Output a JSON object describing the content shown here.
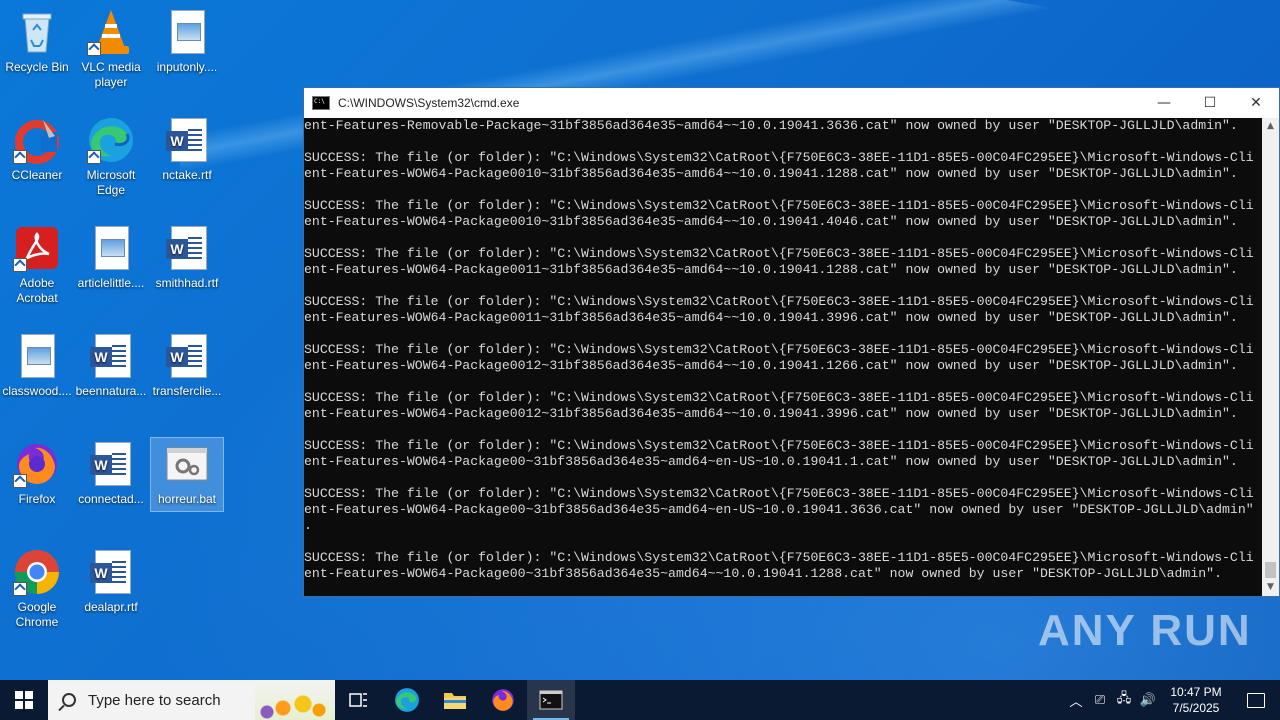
{
  "desktop": {
    "icons": [
      {
        "label": "Recycle Bin"
      },
      {
        "label": "VLC media player"
      },
      {
        "label": "inputonly...."
      },
      {
        "label": "CCleaner"
      },
      {
        "label": "Microsoft Edge"
      },
      {
        "label": "nctake.rtf"
      },
      {
        "label": "Adobe Acrobat"
      },
      {
        "label": "articlelittle...."
      },
      {
        "label": "smithhad.rtf"
      },
      {
        "label": "classwood...."
      },
      {
        "label": "beennatura..."
      },
      {
        "label": "transferclie..."
      },
      {
        "label": "Firefox"
      },
      {
        "label": "connectad..."
      },
      {
        "label": "horreur.bat"
      },
      {
        "label": "Google Chrome"
      },
      {
        "label": "dealapr.rtf"
      }
    ]
  },
  "cmd": {
    "title": "C:\\WINDOWS\\System32\\cmd.exe",
    "controls": {
      "minimize": "—",
      "maximize": "☐",
      "close": "✕"
    },
    "lines": [
      "ent-Features-Removable-Package~31bf3856ad364e35~amd64~~10.0.19041.3636.cat\" now owned by user \"DESKTOP-JGLLJLD\\admin\".",
      "",
      "SUCCESS: The file (or folder): \"C:\\Windows\\System32\\CatRoot\\{F750E6C3-38EE-11D1-85E5-00C04FC295EE}\\Microsoft-Windows-Cli",
      "ent-Features-WOW64-Package0010~31bf3856ad364e35~amd64~~10.0.19041.1288.cat\" now owned by user \"DESKTOP-JGLLJLD\\admin\".",
      "",
      "SUCCESS: The file (or folder): \"C:\\Windows\\System32\\CatRoot\\{F750E6C3-38EE-11D1-85E5-00C04FC295EE}\\Microsoft-Windows-Cli",
      "ent-Features-WOW64-Package0010~31bf3856ad364e35~amd64~~10.0.19041.4046.cat\" now owned by user \"DESKTOP-JGLLJLD\\admin\".",
      "",
      "SUCCESS: The file (or folder): \"C:\\Windows\\System32\\CatRoot\\{F750E6C3-38EE-11D1-85E5-00C04FC295EE}\\Microsoft-Windows-Cli",
      "ent-Features-WOW64-Package0011~31bf3856ad364e35~amd64~~10.0.19041.1288.cat\" now owned by user \"DESKTOP-JGLLJLD\\admin\".",
      "",
      "SUCCESS: The file (or folder): \"C:\\Windows\\System32\\CatRoot\\{F750E6C3-38EE-11D1-85E5-00C04FC295EE}\\Microsoft-Windows-Cli",
      "ent-Features-WOW64-Package0011~31bf3856ad364e35~amd64~~10.0.19041.3996.cat\" now owned by user \"DESKTOP-JGLLJLD\\admin\".",
      "",
      "SUCCESS: The file (or folder): \"C:\\Windows\\System32\\CatRoot\\{F750E6C3-38EE-11D1-85E5-00C04FC295EE}\\Microsoft-Windows-Cli",
      "ent-Features-WOW64-Package0012~31bf3856ad364e35~amd64~~10.0.19041.1266.cat\" now owned by user \"DESKTOP-JGLLJLD\\admin\".",
      "",
      "SUCCESS: The file (or folder): \"C:\\Windows\\System32\\CatRoot\\{F750E6C3-38EE-11D1-85E5-00C04FC295EE}\\Microsoft-Windows-Cli",
      "ent-Features-WOW64-Package0012~31bf3856ad364e35~amd64~~10.0.19041.3996.cat\" now owned by user \"DESKTOP-JGLLJLD\\admin\".",
      "",
      "SUCCESS: The file (or folder): \"C:\\Windows\\System32\\CatRoot\\{F750E6C3-38EE-11D1-85E5-00C04FC295EE}\\Microsoft-Windows-Cli",
      "ent-Features-WOW64-Package00~31bf3856ad364e35~amd64~en-US~10.0.19041.1.cat\" now owned by user \"DESKTOP-JGLLJLD\\admin\".",
      "",
      "SUCCESS: The file (or folder): \"C:\\Windows\\System32\\CatRoot\\{F750E6C3-38EE-11D1-85E5-00C04FC295EE}\\Microsoft-Windows-Cli",
      "ent-Features-WOW64-Package00~31bf3856ad364e35~amd64~en-US~10.0.19041.3636.cat\" now owned by user \"DESKTOP-JGLLJLD\\admin\"",
      ".",
      "",
      "SUCCESS: The file (or folder): \"C:\\Windows\\System32\\CatRoot\\{F750E6C3-38EE-11D1-85E5-00C04FC295EE}\\Microsoft-Windows-Cli",
      "ent-Features-WOW64-Package00~31bf3856ad364e35~amd64~~10.0.19041.1288.cat\" now owned by user \"DESKTOP-JGLLJLD\\admin\"."
    ]
  },
  "watermark": "ANY RUN",
  "taskbar": {
    "search_placeholder": "Type here to search",
    "clock_time": "10:47 PM",
    "clock_date": "7/5/2025"
  }
}
